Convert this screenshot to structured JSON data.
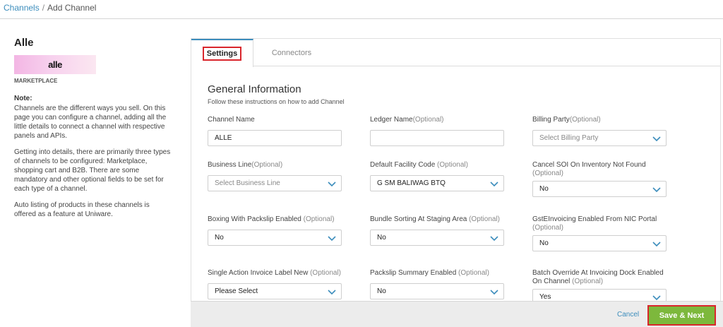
{
  "breadcrumb": {
    "parent": "Channels",
    "separator": "/",
    "current": "Add Channel"
  },
  "channel": {
    "name": "Alle",
    "logo_text": "alle",
    "type": "MARKETPLACE"
  },
  "note": {
    "title": "Note:",
    "paragraphs": [
      "Channels are the different ways you sell. On this page you can configure a channel, adding all the little details to connect a channel with respective panels and APIs.",
      "Getting into details, there are primarily three types of channels to be configured: Marketplace, shopping cart and B2B. There are some mandatory and other optional fields to be set for each type of a channel.",
      "Auto listing of products in these channels is offered as a feature at Uniware."
    ]
  },
  "tabs": [
    {
      "label": "Settings"
    },
    {
      "label": "Connectors"
    }
  ],
  "general": {
    "title": "General Information",
    "subtitle": "Follow these instructions on how to add Channel"
  },
  "fields": {
    "channel_name": {
      "label": "Channel Name",
      "value": "ALLE"
    },
    "ledger_name": {
      "label": "Ledger Name",
      "optional": "(Optional)",
      "value": ""
    },
    "billing_party": {
      "label": "Billing Party",
      "optional": "(Optional)",
      "value": "Select Billing Party"
    },
    "business_line": {
      "label": "Business Line",
      "optional": "(Optional)",
      "value": "Select Business Line"
    },
    "default_facility": {
      "label": "Default Facility Code",
      "optional": " (Optional)",
      "value": "G SM BALIWAG BTQ"
    },
    "cancel_soi": {
      "label": "Cancel SOI On Inventory Not Found",
      "optional": "(Optional)",
      "value": "No"
    },
    "boxing": {
      "label": "Boxing With Packslip Enabled",
      "optional": " (Optional)",
      "value": "No"
    },
    "bundle_sorting": {
      "label": "Bundle Sorting At Staging Area",
      "optional": " (Optional)",
      "value": "No"
    },
    "gst_einvoicing": {
      "label": "GstEInvoicing Enabled From NIC Portal",
      "optional": "(Optional)",
      "value": "No"
    },
    "single_action": {
      "label": "Single Action Invoice Label New",
      "optional": " (Optional)",
      "value": "Please Select"
    },
    "packslip_summary": {
      "label": "Packslip Summary Enabled",
      "optional": " (Optional)",
      "value": "No"
    },
    "batch_override": {
      "label": "Batch Override At Invoicing Dock Enabled On Channel",
      "optional": " (Optional)",
      "value": "Yes"
    }
  },
  "footer": {
    "cancel_label": "Cancel",
    "save_label": "Save & Next"
  },
  "colors": {
    "link": "#3c8dbc",
    "primary_button": "#7db83c",
    "highlight_border": "#d9262c",
    "footer_bg": "#ececec"
  }
}
